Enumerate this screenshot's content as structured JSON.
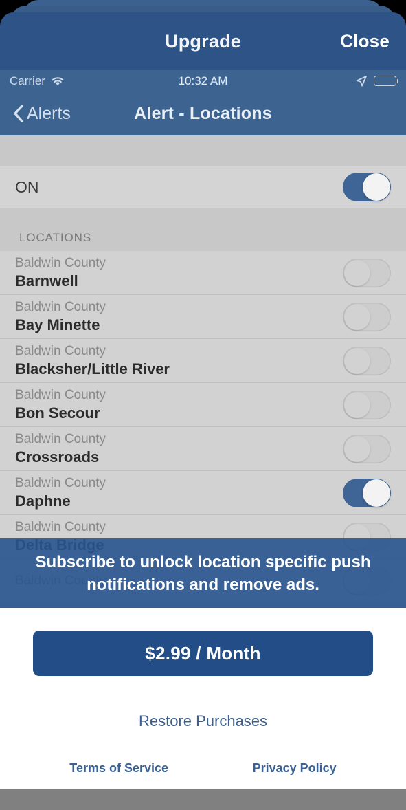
{
  "modal": {
    "title": "Upgrade",
    "close_label": "Close"
  },
  "status_bar": {
    "carrier": "Carrier",
    "time": "10:32 AM",
    "wifi_icon": "wifi-icon",
    "location_icon": "location-arrow-icon",
    "battery_icon": "battery-icon"
  },
  "nav_bar": {
    "back_label": "Alerts",
    "back_icon": "chevron-left-icon",
    "title": "Alert - Locations"
  },
  "settings": {
    "master_toggle_label": "ON",
    "master_toggle_state": "on",
    "section_header": "LOCATIONS"
  },
  "locations": [
    {
      "county": "Baldwin County",
      "name": "Barnwell",
      "state": "off"
    },
    {
      "county": "Baldwin County",
      "name": "Bay Minette",
      "state": "off"
    },
    {
      "county": "Baldwin County",
      "name": "Blacksher/Little River",
      "state": "off"
    },
    {
      "county": "Baldwin County",
      "name": "Bon Secour",
      "state": "off"
    },
    {
      "county": "Baldwin County",
      "name": "Crossroads",
      "state": "off"
    },
    {
      "county": "Baldwin County",
      "name": "Daphne",
      "state": "on"
    },
    {
      "county": "Baldwin County",
      "name": "Delta Bridge",
      "state": "off"
    },
    {
      "county": "Baldwin County",
      "name": "",
      "state": "off"
    }
  ],
  "banner": {
    "message": "Subscribe to unlock location specific push notifications and remove ads."
  },
  "purchase": {
    "price_label": "$2.99 / Month",
    "restore_label": "Restore Purchases",
    "terms_label": "Terms of Service",
    "privacy_label": "Privacy Policy"
  },
  "colors": {
    "brand_blue": "#2e5387",
    "nav_blue": "#3d6391",
    "button_blue": "#234d87",
    "toggle_on": "#3f6596",
    "link_blue": "#3a6196",
    "panel_gray": "#c8c8c8"
  }
}
